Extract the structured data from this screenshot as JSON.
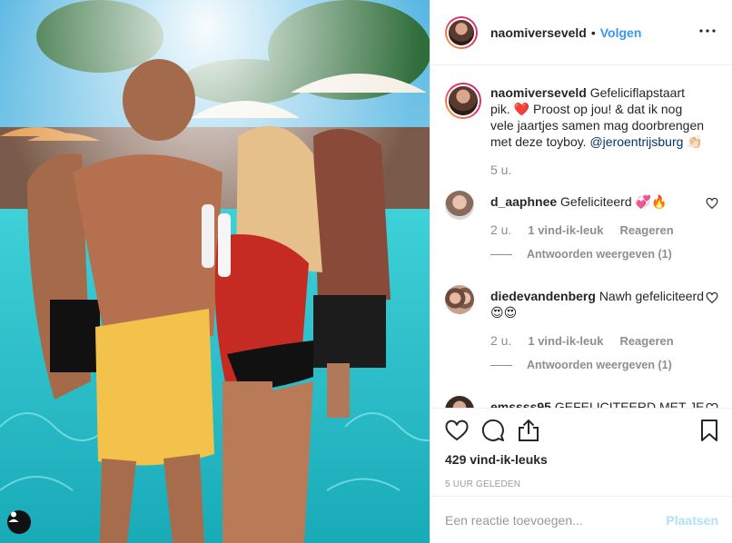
{
  "header": {
    "username": "naomiverseveld",
    "dot": "•",
    "follow_label": "Volgen",
    "more_icon": "more-horizontal-icon"
  },
  "caption": {
    "username": "naomiverseveld",
    "text_before_heart": "Gefeliciflapstaart pik.",
    "heart_emoji": "❤️",
    "text_after_heart": "Proost op jou! & dat ik nog vele jaartjes samen mag doorbrengen met deze toyboy.",
    "mention": "@jeroentrijsburg",
    "emoji_end": "👏🏻",
    "time": "5 u."
  },
  "comments": [
    {
      "username": "d_aaphnee",
      "text": "Gefeliciteerd 💞🔥",
      "time": "2 u.",
      "likes": "1 vind-ik-leuk",
      "reply_label": "Reageren",
      "view_replies": "Antwoorden weergeven (1)"
    },
    {
      "username": "diedevandenberg",
      "text": "Nawh gefeliciteerd😍😍",
      "time": "2 u.",
      "likes": "1 vind-ik-leuk",
      "reply_label": "Reageren",
      "view_replies": "Antwoorden weergeven (1)"
    },
    {
      "username": "emssss95",
      "text": "GEFELICITEERD MET JE MAN❤"
    }
  ],
  "actions": {
    "like_icon": "heart-outline-icon",
    "comment_icon": "comment-bubble-icon",
    "share_icon": "share-upload-icon",
    "save_icon": "bookmark-icon",
    "likes_count": "429 vind-ik-leuks",
    "posted_time": "5 UUR GELEDEN"
  },
  "add_comment": {
    "placeholder": "Een reactie toevoegen...",
    "post_label": "Plaatsen"
  },
  "colors": {
    "link_blue": "#3897f0",
    "post_disabled": "#b2dffc",
    "muted_text": "#8e8e8e",
    "border": "#efefef"
  }
}
